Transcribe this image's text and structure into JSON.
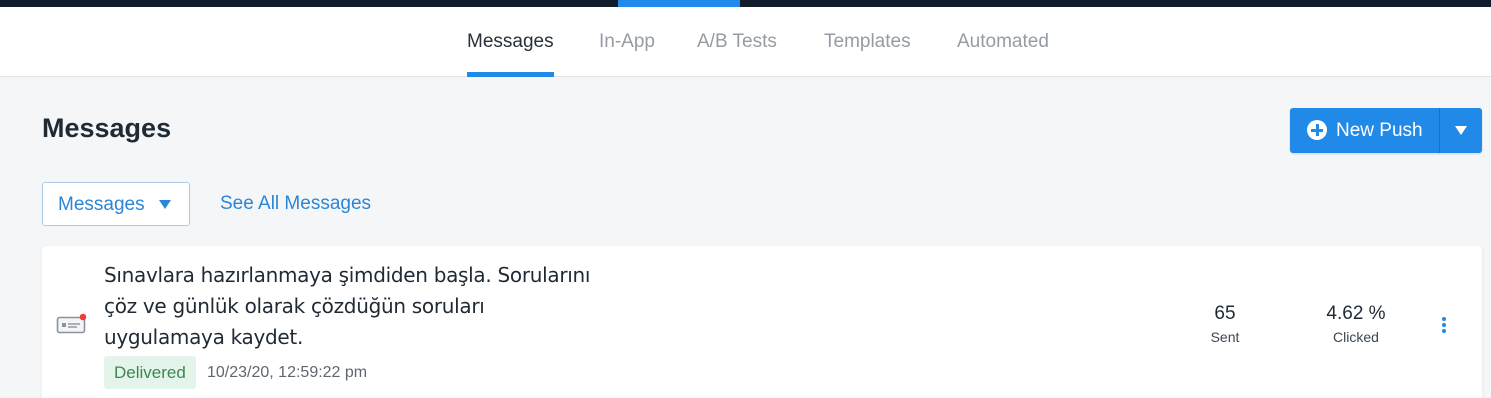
{
  "nav": {
    "tabs": [
      {
        "label": "Messages",
        "active": true
      },
      {
        "label": "In-App",
        "active": false
      },
      {
        "label": "A/B Tests",
        "active": false
      },
      {
        "label": "Templates",
        "active": false
      },
      {
        "label": "Automated",
        "active": false
      }
    ]
  },
  "header": {
    "title": "Messages",
    "new_push_label": "New Push"
  },
  "filters": {
    "selected": "Messages",
    "see_all_label": "See All Messages"
  },
  "messages": [
    {
      "text": "Sınavlara hazırlanmaya şimdiden başla. Sorularını çöz ve günlük olarak çözdüğün soruları uygulamaya kaydet.",
      "status": "Delivered",
      "timestamp": "10/23/20, 12:59:22 pm",
      "sent_value": "65",
      "sent_label": "Sent",
      "clicked_value": "4.62 %",
      "clicked_label": "Clicked"
    }
  ],
  "colors": {
    "accent": "#2189e8",
    "top_bar": "#101c2b",
    "status_delivered_bg": "#e5f4ea",
    "status_delivered_text": "#3b8754"
  },
  "icons": {
    "new_push": "plus-circle-icon",
    "dropdown": "caret-down-icon",
    "message": "push-notification-icon",
    "menu": "kebab-menu-icon"
  }
}
